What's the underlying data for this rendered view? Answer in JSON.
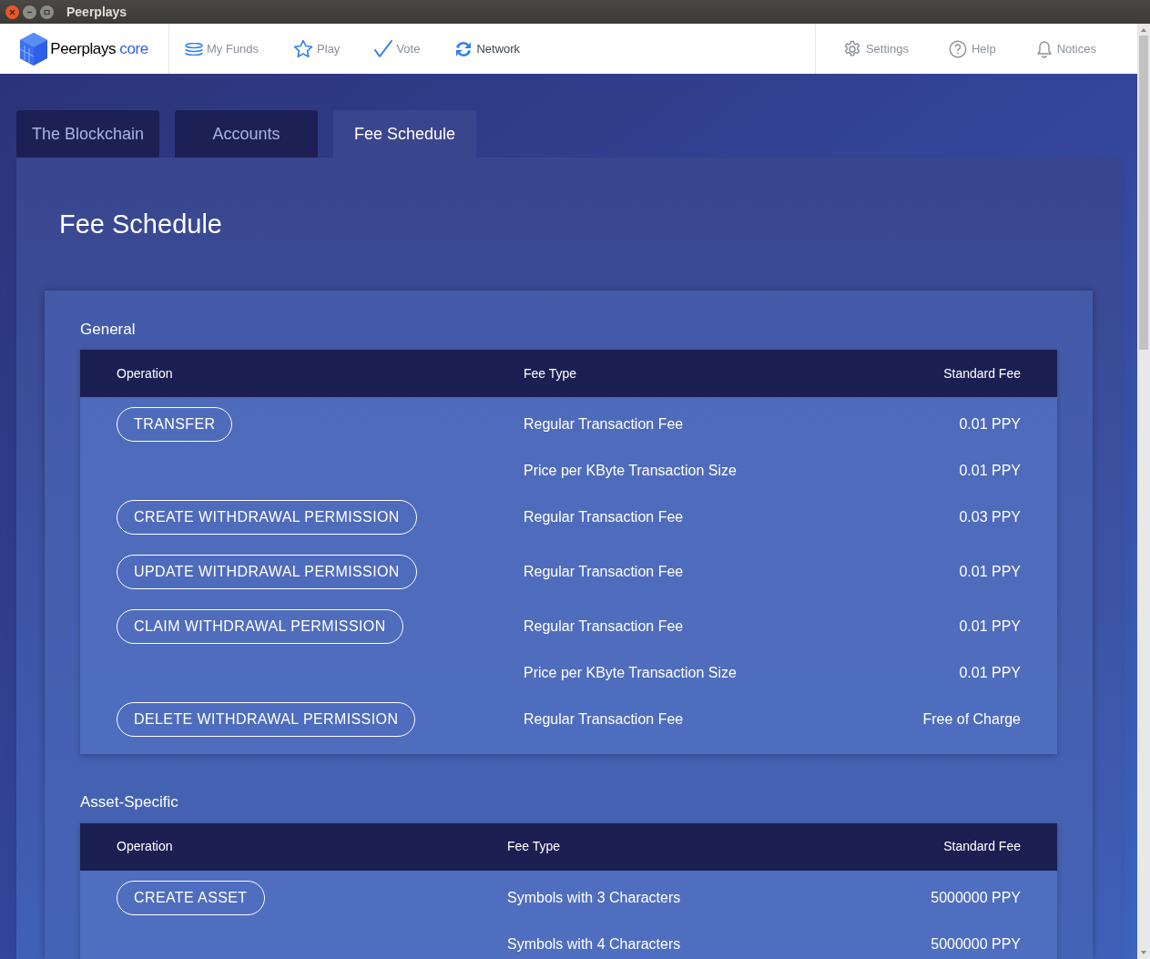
{
  "window": {
    "title": "Peerplays"
  },
  "logo": {
    "name": "Peerplays",
    "suffix": "core"
  },
  "nav": [
    {
      "label": "My Funds",
      "selected": false
    },
    {
      "label": "Play",
      "selected": false
    },
    {
      "label": "Vote",
      "selected": false
    },
    {
      "label": "Network",
      "selected": true
    }
  ],
  "nav_right": [
    {
      "label": "Settings"
    },
    {
      "label": "Help"
    },
    {
      "label": "Notices"
    }
  ],
  "tabs": [
    {
      "label": "The Blockchain",
      "selected": false
    },
    {
      "label": "Accounts",
      "selected": false
    },
    {
      "label": "Fee Schedule",
      "selected": true
    }
  ],
  "page_title": "Fee Schedule",
  "sections": [
    {
      "title": "General",
      "columns": [
        "Operation",
        "Fee Type",
        "Standard Fee"
      ],
      "rows": [
        {
          "operation": "TRANSFER",
          "fee_type": "Regular Transaction Fee",
          "fee": "0.01 PPY"
        },
        {
          "fee_type": "Price per KByte Transaction Size",
          "fee": "0.01 PPY"
        },
        {
          "operation": "CREATE WITHDRAWAL PERMISSION",
          "fee_type": "Regular Transaction Fee",
          "fee": "0.03 PPY"
        },
        {
          "operation": "UPDATE WITHDRAWAL PERMISSION",
          "fee_type": "Regular Transaction Fee",
          "fee": "0.01 PPY"
        },
        {
          "operation": "CLAIM WITHDRAWAL PERMISSION",
          "fee_type": "Regular Transaction Fee",
          "fee": "0.01 PPY"
        },
        {
          "fee_type": "Price per KByte Transaction Size",
          "fee": "0.01 PPY"
        },
        {
          "operation": "DELETE WITHDRAWAL PERMISSION",
          "fee_type": "Regular Transaction Fee",
          "fee": "Free of Charge"
        }
      ]
    },
    {
      "title": "Asset-Specific",
      "columns": [
        "Operation",
        "Fee Type",
        "Standard Fee"
      ],
      "rows": [
        {
          "operation": "CREATE ASSET",
          "fee_type": "Symbols with 3 Characters",
          "fee": "5000000 PPY"
        },
        {
          "fee_type": "Symbols with 4 Characters",
          "fee": "5000000 PPY"
        }
      ]
    }
  ]
}
